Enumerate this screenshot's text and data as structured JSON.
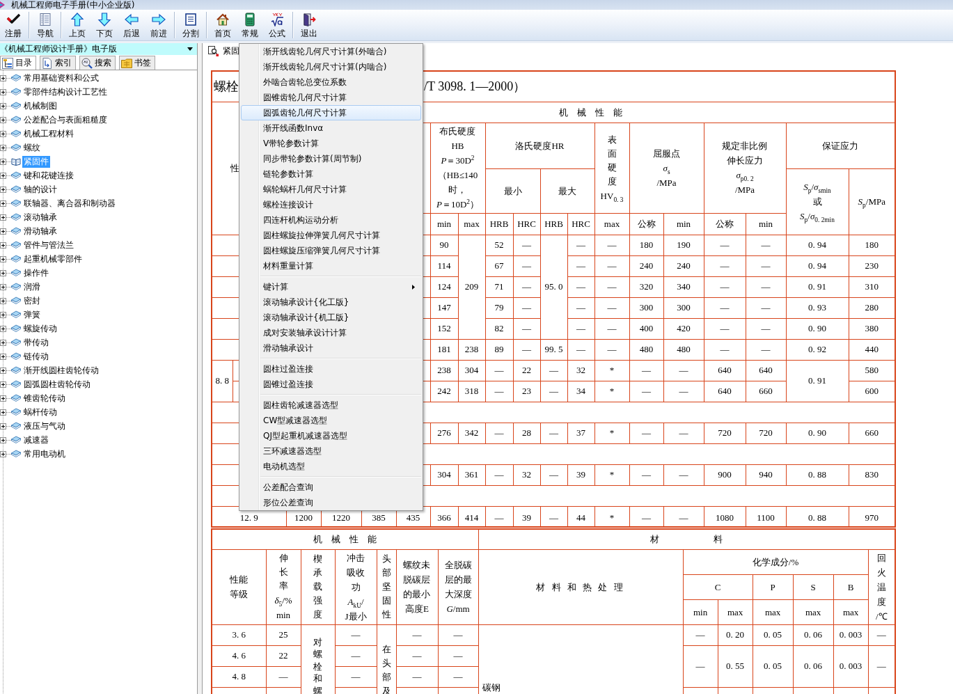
{
  "window": {
    "title": "机械工程师电子手册(中小企业版)"
  },
  "toolbar": {
    "groups": [
      {
        "buttons": [
          {
            "label": "注册"
          }
        ]
      },
      {
        "buttons": [
          {
            "label": "导航"
          }
        ]
      },
      {
        "buttons": [
          {
            "label": "上页"
          },
          {
            "label": "下页"
          },
          {
            "label": "后退"
          },
          {
            "label": "前进"
          }
        ]
      },
      {
        "buttons": [
          {
            "label": "分割"
          }
        ]
      },
      {
        "buttons": [
          {
            "label": "首页"
          },
          {
            "label": "常规"
          },
          {
            "label": "公式"
          }
        ]
      },
      {
        "buttons": [
          {
            "label": "退出"
          }
        ]
      }
    ]
  },
  "book_selector": {
    "value": "《机械工程师设计手册》电子版"
  },
  "tabs": [
    {
      "label": "目录",
      "selected": true
    },
    {
      "label": "索引",
      "selected": false
    },
    {
      "label": "搜索",
      "selected": false
    },
    {
      "label": "书签",
      "selected": false
    }
  ],
  "tree": {
    "items": [
      {
        "label": "常用基础资料和公式",
        "expanded": false,
        "selected": false
      },
      {
        "label": "零部件结构设计工艺性",
        "expanded": false,
        "selected": false
      },
      {
        "label": "机械制图",
        "expanded": false,
        "selected": false
      },
      {
        "label": "公差配合与表面粗糙度",
        "expanded": false,
        "selected": false
      },
      {
        "label": "机械工程材料",
        "expanded": false,
        "selected": false
      },
      {
        "label": "螺纹",
        "expanded": false,
        "selected": false
      },
      {
        "label": "紧固件",
        "expanded": false,
        "selected": true
      },
      {
        "label": "键和花键连接",
        "expanded": false,
        "selected": false
      },
      {
        "label": "轴的设计",
        "expanded": false,
        "selected": false
      },
      {
        "label": "联轴器、离合器和制动器",
        "expanded": false,
        "selected": false
      },
      {
        "label": "滚动轴承",
        "expanded": false,
        "selected": false
      },
      {
        "label": "滑动轴承",
        "expanded": false,
        "selected": false
      },
      {
        "label": "管件与管法兰",
        "expanded": false,
        "selected": false
      },
      {
        "label": "起重机械零部件",
        "expanded": false,
        "selected": false
      },
      {
        "label": "操作件",
        "expanded": false,
        "selected": false
      },
      {
        "label": "润滑",
        "expanded": false,
        "selected": false
      },
      {
        "label": "密封",
        "expanded": false,
        "selected": false
      },
      {
        "label": "弹簧",
        "expanded": false,
        "selected": false
      },
      {
        "label": "螺旋传动",
        "expanded": false,
        "selected": false
      },
      {
        "label": "带传动",
        "expanded": false,
        "selected": false
      },
      {
        "label": "链传动",
        "expanded": false,
        "selected": false
      },
      {
        "label": "渐开线圆柱齿轮传动",
        "expanded": false,
        "selected": false
      },
      {
        "label": "圆弧圆柱齿轮传动",
        "expanded": false,
        "selected": false
      },
      {
        "label": "锥齿轮传动",
        "expanded": false,
        "selected": false
      },
      {
        "label": "蜗杆传动",
        "expanded": false,
        "selected": false
      },
      {
        "label": "液压与气动",
        "expanded": false,
        "selected": false
      },
      {
        "label": "减速器",
        "expanded": false,
        "selected": false
      },
      {
        "label": "常用电动机",
        "expanded": false,
        "selected": false
      }
    ]
  },
  "document_tab": {
    "label": "紧固"
  },
  "spec_table": {
    "title_left": "螺栓",
    "title_right": "/T 3098. 1—2000）",
    "section_header": "机　械　性　能",
    "grade_header": "性",
    "headers": [
      "布氏硬度\nHB\n*P*＝30D$^{2}$\n（HB≤140\n时，\n*P*＝10D$^{2}$）",
      "洛氏硬度HR",
      [
        "表面硬度",
        "HV$_{0. 3}$"
      ],
      "屈服点\n*σ*$_{s}$\n/MPa",
      "规定非比例伸长应力\n*σ*$_{p0. 2}$\n/MPa",
      "保证应力",
      "最小",
      "最大",
      "*S*$_{p}$/*σ*$_{smin}$\n或\n*S*$_{p}$/*σ*$_{0. 2min}$",
      "*S*$_{p}$/MPa",
      "min",
      "max",
      "HRB",
      "HRC",
      "HRB",
      "HRC",
      "max",
      "公称",
      "min",
      "公称",
      "min"
    ],
    "rows": [
      {
        "cells": [
          {
            "text": "",
            "colspan": 2
          },
          "",
          "",
          "",
          "",
          "90",
          {
            "text": "209",
            "rowspan": 5
          },
          "52",
          "—",
          {
            "text": "95. 0",
            "rowspan": 5
          },
          "—",
          "—",
          "180",
          "190",
          "—",
          "—",
          "0. 94",
          "180"
        ]
      },
      {
        "cells": [
          {
            "text": "",
            "colspan": 2
          },
          "",
          "",
          "",
          "",
          "114",
          "67",
          "—",
          "—",
          "—",
          "240",
          "240",
          "—",
          "—",
          "0. 94",
          "230"
        ]
      },
      {
        "cells": [
          {
            "text": "",
            "colspan": 2
          },
          "",
          "",
          "",
          "",
          "124",
          "71",
          "—",
          "—",
          "—",
          "320",
          "340",
          "—",
          "—",
          "0. 91",
          "310"
        ]
      },
      {
        "cells": [
          {
            "text": "",
            "colspan": 2
          },
          "",
          "",
          "",
          "",
          "147",
          "79",
          "—",
          "—",
          "—",
          "300",
          "300",
          "—",
          "—",
          "0. 93",
          "280"
        ]
      },
      {
        "cells": [
          {
            "text": "",
            "colspan": 2
          },
          "",
          "",
          "",
          "",
          "152",
          "82",
          "—",
          "—",
          "—",
          "400",
          "420",
          "—",
          "—",
          "0. 90",
          "380"
        ]
      },
      {
        "cells": [
          {
            "text": "",
            "colspan": 2
          },
          "",
          "",
          "",
          "",
          "181",
          "238",
          "89",
          "—",
          "99. 5",
          "—",
          "—",
          "480",
          "480",
          "—",
          "—",
          "0. 92",
          "440"
        ]
      },
      {
        "cells": [
          {
            "text": "8. 8",
            "rowspan": 2
          },
          "",
          "",
          "",
          "",
          "",
          "238",
          "304",
          "—",
          "22",
          "—",
          "32",
          "*",
          "—",
          "—",
          "640",
          "640",
          {
            "text": "0. 91",
            "rowspan": 2
          },
          "580"
        ]
      },
      {
        "cells": [
          "",
          "",
          "",
          "",
          "",
          "242",
          "318",
          "—",
          "23",
          "—",
          "34",
          "*",
          "—",
          "—",
          "640",
          "660",
          "600"
        ]
      },
      {
        "cells": [
          {
            "text": "",
            "colspan": 2
          },
          "",
          "",
          "",
          "",
          "276",
          "342",
          "—",
          "28",
          "—",
          "37",
          "*",
          "—",
          "—",
          "720",
          "720",
          "0. 90",
          "660"
        ]
      },
      {
        "cells": [
          {
            "text": "",
            "colspan": 2
          },
          "",
          "",
          "",
          "",
          "304",
          "361",
          "—",
          "32",
          "—",
          "39",
          "*",
          "—",
          "—",
          "900",
          "940",
          "0. 88",
          "830"
        ]
      },
      {
        "cells": [
          {
            "text": "12. 9",
            "colspan": 2
          },
          "1200",
          "1220",
          "385",
          "435",
          "366",
          "414",
          "—",
          "39",
          "—",
          "44",
          "*",
          "—",
          "—",
          "1080",
          "1100",
          "0. 88",
          "970"
        ]
      }
    ]
  },
  "material_table": {
    "section_headers": [
      "机　械　性　能",
      "材　　　　　　料"
    ],
    "headers": [
      "性能等级",
      [
        "伸长率",
        "*δ*$_{5}$/%\nmin"
      ],
      "楔承载强度",
      "冲击吸收功\n*A*$_{kU}$/\nJ最小",
      "头部坚固性",
      "螺纹未脱碳层的最小高度E",
      "全脱碳层的最大深度\n*G*/mm",
      "材 料 和 热 处 理",
      "化学成分/%",
      "C",
      "P",
      "S",
      "B",
      "min",
      "max",
      "max",
      "max",
      "max",
      "回火温度\n/℃"
    ],
    "rows": [
      {
        "cells": [
          "3. 6",
          "25",
          {
            "text": "对螺栓和螺",
            "rowspan": 4
          },
          "—",
          {
            "text": "在头部及",
            "rowspan": 4
          },
          "—",
          "—",
          {
            "text": "碳钢",
            "rowspan": 4
          },
          "—",
          "0. 20",
          "0. 05",
          "0. 06",
          "0. 003",
          "—"
        ]
      },
      {
        "cells": [
          "4. 6",
          "22",
          "—",
          "—",
          "—",
          {
            "text": "—",
            "rowspan": 2
          },
          {
            "text": "0. 55",
            "rowspan": 2
          },
          {
            "text": "0. 05",
            "rowspan": 2
          },
          {
            "text": "0. 06",
            "rowspan": 2
          },
          {
            "text": "0. 003",
            "rowspan": 2
          },
          {
            "text": "—",
            "rowspan": 2
          }
        ]
      },
      {
        "cells": [
          "4. 8",
          "—",
          "—",
          "—",
          "—"
        ]
      }
    ]
  },
  "context_menu": {
    "groups": [
      {
        "items": [
          {
            "label": "渐开线齿轮几何尺寸计算(外啮合)",
            "selected": false,
            "submenu": false
          },
          {
            "label": "渐开线齿轮几何尺寸计算(内啮合)",
            "selected": false,
            "submenu": false
          },
          {
            "label": "外啮合齿轮总变位系数",
            "selected": false,
            "submenu": false
          },
          {
            "label": "圆锥齿轮几何尺寸计算",
            "selected": false,
            "submenu": false
          },
          {
            "label": "圆弧齿轮几何尺寸计算",
            "selected": true,
            "submenu": false
          },
          {
            "label": "渐开线函数Invα",
            "selected": false,
            "submenu": false
          },
          {
            "label": "V带轮参数计算",
            "selected": false,
            "submenu": false
          },
          {
            "label": "同步带轮参数计算(周节制)",
            "selected": false,
            "submenu": false
          },
          {
            "label": "链轮参数计算",
            "selected": false,
            "submenu": false
          },
          {
            "label": "蜗轮蜗杆几何尺寸计算",
            "selected": false,
            "submenu": false
          },
          {
            "label": "螺栓连接设计",
            "selected": false,
            "submenu": false
          },
          {
            "label": "四连杆机构运动分析",
            "selected": false,
            "submenu": false
          },
          {
            "label": "圆柱螺旋拉伸弹簧几何尺寸计算",
            "selected": false,
            "submenu": false
          },
          {
            "label": "圆柱螺旋压缩弹簧几何尺寸计算",
            "selected": false,
            "submenu": false
          },
          {
            "label": "材料重量计算",
            "selected": false,
            "submenu": false
          }
        ]
      },
      {
        "items": [
          {
            "label": "键计算",
            "selected": false,
            "submenu": true
          },
          {
            "label": "滚动轴承设计{化工版}",
            "selected": false,
            "submenu": false
          },
          {
            "label": "滚动轴承设计{机工版}",
            "selected": false,
            "submenu": false
          },
          {
            "label": "成对安装轴承设计计算",
            "selected": false,
            "submenu": false
          },
          {
            "label": "滑动轴承设计",
            "selected": false,
            "submenu": false
          }
        ]
      },
      {
        "items": [
          {
            "label": "圆柱过盈连接",
            "selected": false,
            "submenu": false
          },
          {
            "label": "圆锥过盈连接",
            "selected": false,
            "submenu": false
          }
        ]
      },
      {
        "items": [
          {
            "label": "圆柱齿轮减速器选型",
            "selected": false,
            "submenu": false
          },
          {
            "label": "CW型减速器选型",
            "selected": false,
            "submenu": false
          },
          {
            "label": "QJ型起重机减速器选型",
            "selected": false,
            "submenu": false
          },
          {
            "label": "三环减速器选型",
            "selected": false,
            "submenu": false
          },
          {
            "label": "电动机选型",
            "selected": false,
            "submenu": false
          }
        ]
      },
      {
        "items": [
          {
            "label": "公差配合查询",
            "selected": false,
            "submenu": false
          },
          {
            "label": "形位公差查询",
            "selected": false,
            "submenu": false
          }
        ]
      }
    ]
  }
}
